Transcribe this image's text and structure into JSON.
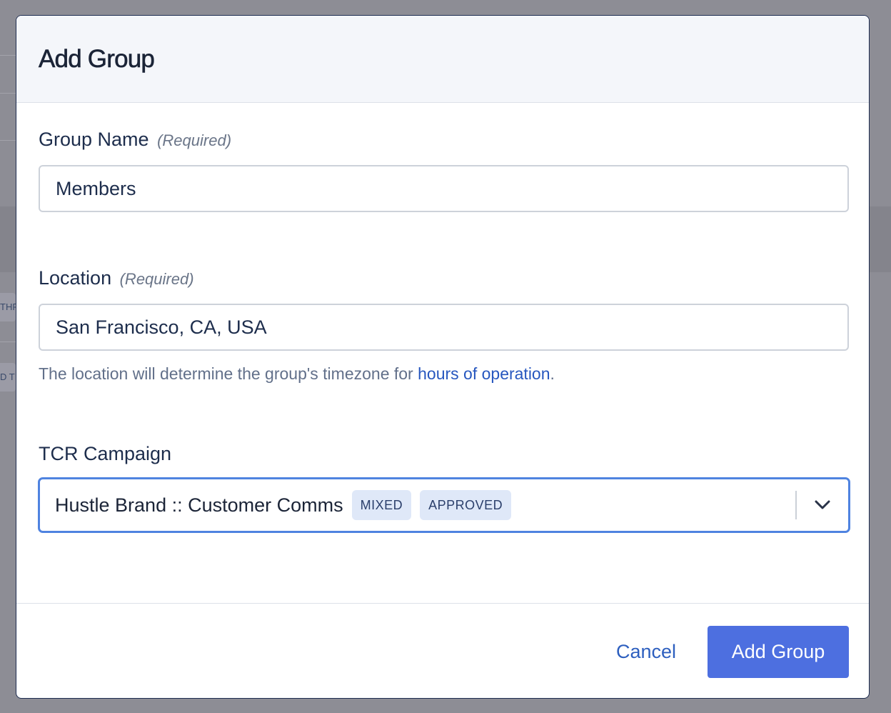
{
  "background": {
    "chip_1_text": "THR",
    "chip_2_text": "D TI"
  },
  "modal": {
    "title": "Add Group",
    "group_name": {
      "label": "Group Name",
      "required_hint": "(Required)",
      "value": "Members"
    },
    "location": {
      "label": "Location",
      "required_hint": "(Required)",
      "value": "San Francisco, CA, USA",
      "help_prefix": "The location will determine the group's timezone for",
      "help_link": "hours of operation",
      "help_suffix": "."
    },
    "tcr_campaign": {
      "label": "TCR Campaign",
      "selected_value": "Hustle Brand :: Customer Comms",
      "tags": [
        "MIXED",
        "APPROVED"
      ],
      "dropdown_icon": "chevron-down-icon"
    },
    "footer": {
      "cancel_label": "Cancel",
      "submit_label": "Add Group"
    }
  },
  "colors": {
    "primary": "#4d6fe0",
    "link": "#2757bf",
    "focus_border": "#4f83e0",
    "tag_background": "#dfe8f8",
    "backdrop": "#8d8d95"
  }
}
